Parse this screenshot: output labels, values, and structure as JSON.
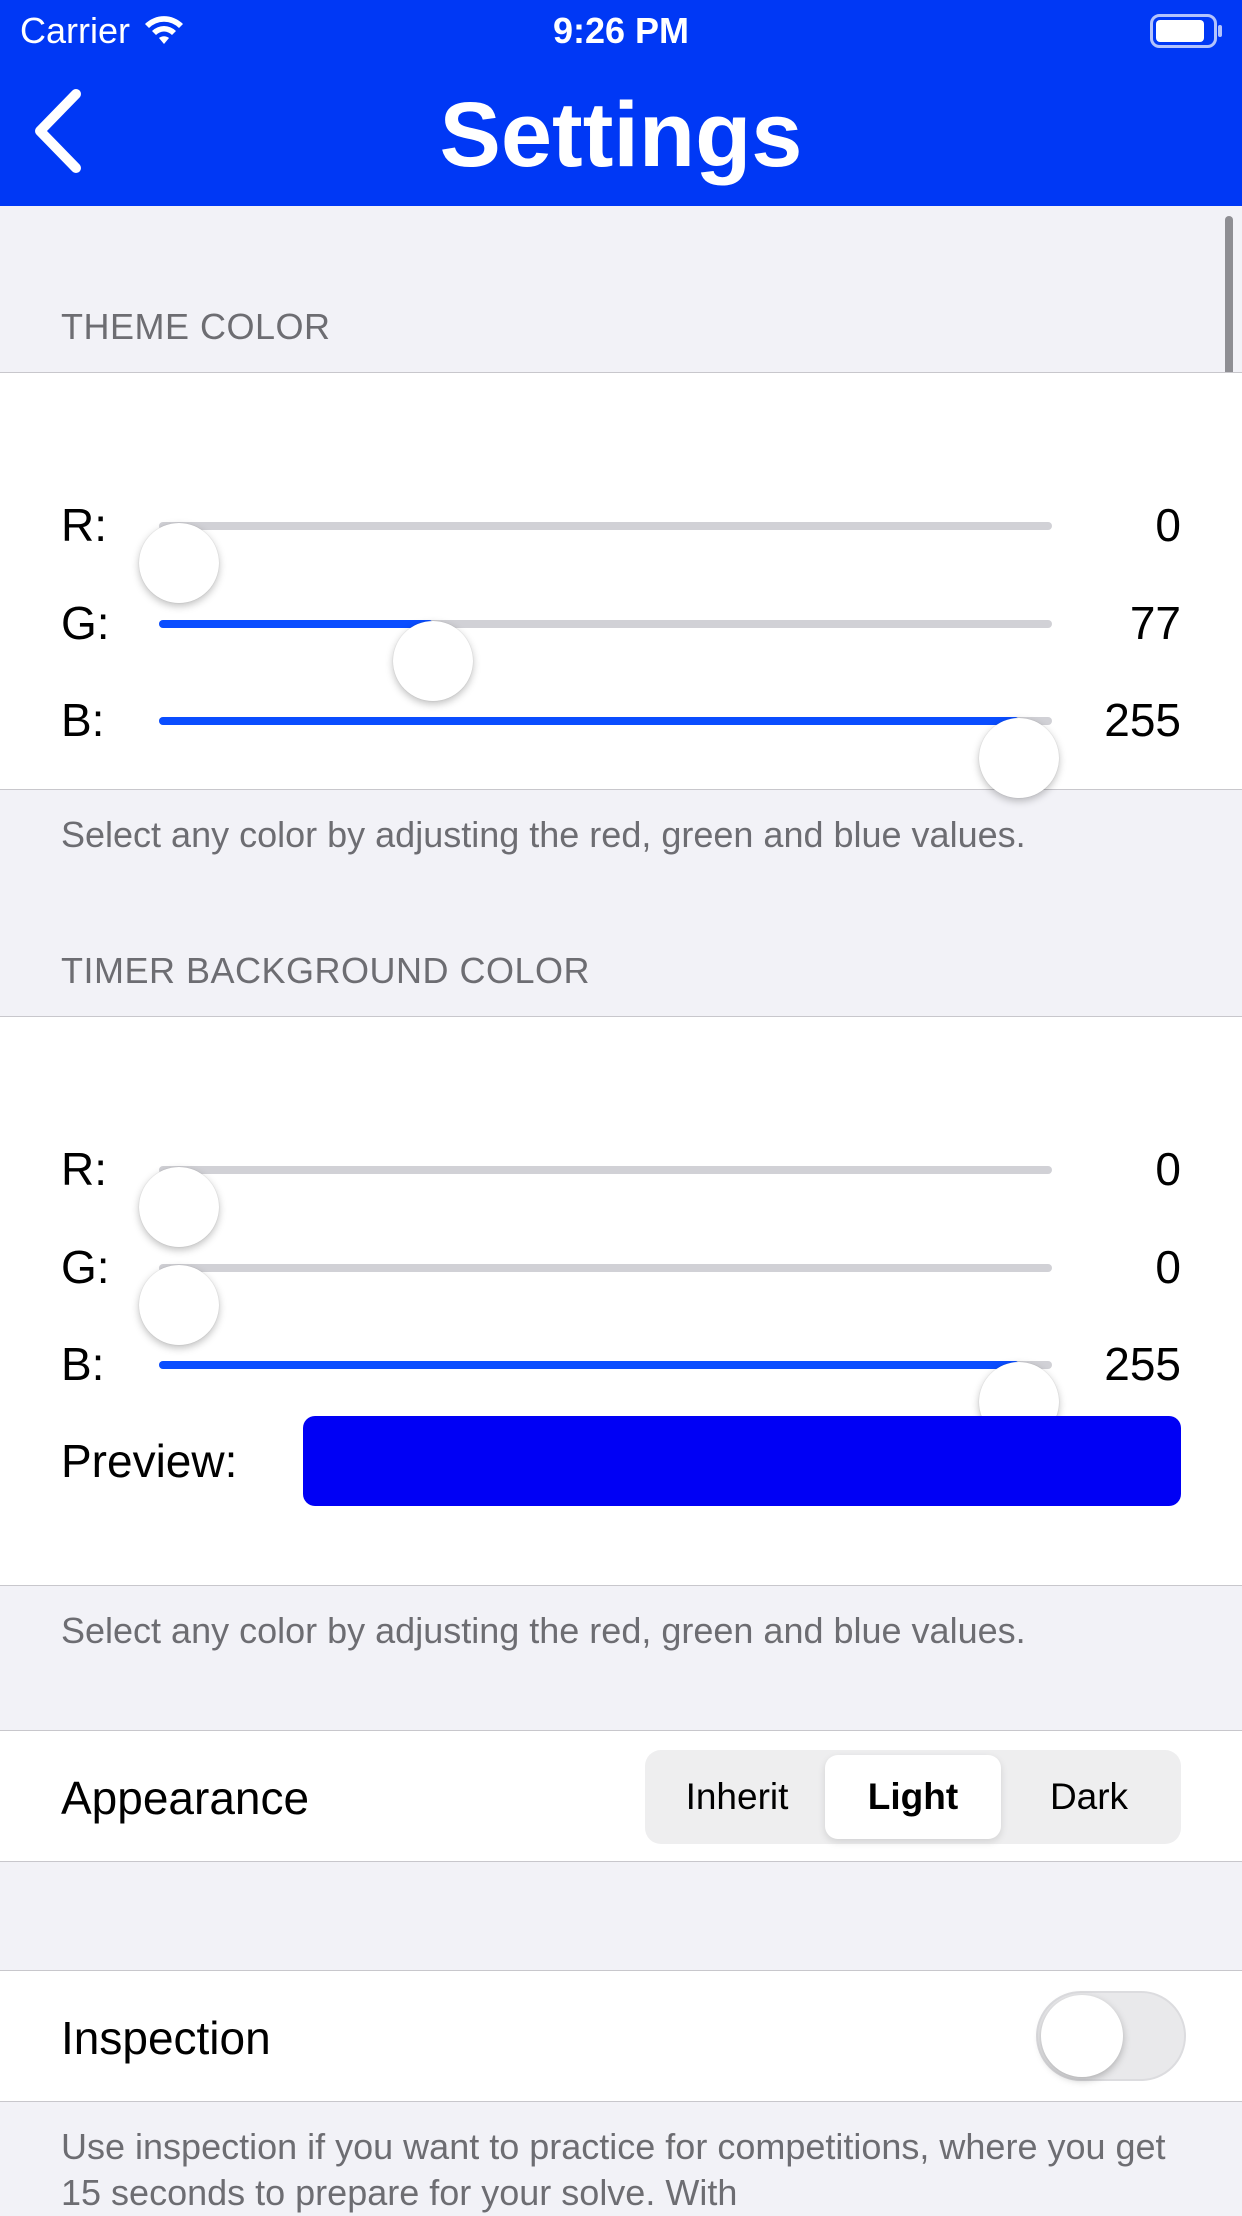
{
  "status_bar": {
    "carrier": "Carrier",
    "time": "9:26 PM"
  },
  "nav": {
    "title": "Settings",
    "back_icon": "chevron-left-icon",
    "background_color": "#0038f5"
  },
  "theme_color": {
    "header": "THEME COLOR",
    "sliders": [
      {
        "label": "R:",
        "value": "0",
        "level": 0
      },
      {
        "label": "G:",
        "value": "77",
        "level": 77
      },
      {
        "label": "B:",
        "value": "255",
        "level": 255
      }
    ],
    "footer": "Select any color by adjusting the red, green and blue values."
  },
  "timer_background_color": {
    "header": "TIMER BACKGROUND COLOR",
    "sliders": [
      {
        "label": "R:",
        "value": "0",
        "level": 0
      },
      {
        "label": "G:",
        "value": "0",
        "level": 0
      },
      {
        "label": "B:",
        "value": "255",
        "level": 255
      }
    ],
    "preview_label": "Preview:",
    "preview_color": "#0000f5",
    "footer": "Select any color by adjusting the red, green and blue values."
  },
  "appearance": {
    "label": "Appearance",
    "options": [
      "Inherit",
      "Light",
      "Dark"
    ],
    "selected": "Light"
  },
  "inspection": {
    "label": "Inspection",
    "enabled": false,
    "footer": "Use inspection if you want to practice for competitions, where you get 15 seconds to prepare for your solve. With"
  },
  "colors": {
    "accent": "#0a4dff",
    "track": "#d1d1d6",
    "background": "#f2f2f7"
  }
}
